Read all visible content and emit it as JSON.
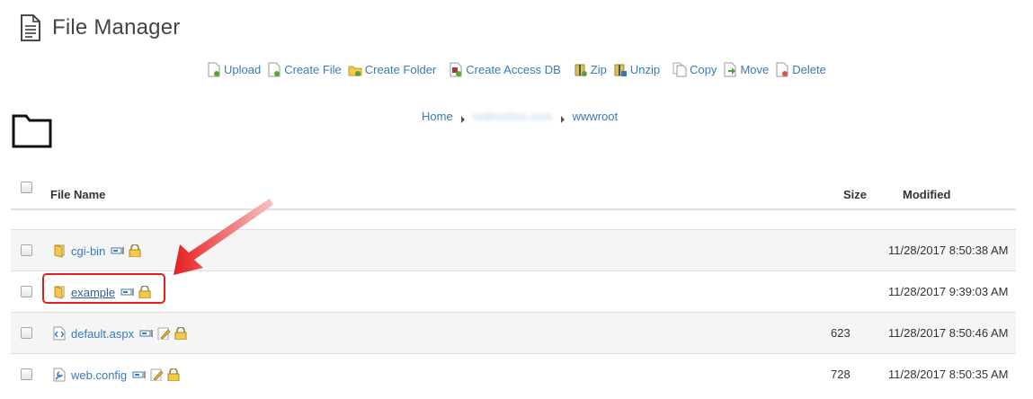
{
  "header": {
    "title": "File Manager",
    "icon": "document-icon"
  },
  "toolbar": [
    {
      "label": "Upload",
      "icon": "upload-icon"
    },
    {
      "label": "Create File",
      "icon": "create-file-icon"
    },
    {
      "label": "Create Folder",
      "icon": "create-folder-icon"
    },
    {
      "label": "Create Access DB",
      "icon": "create-access-db-icon"
    },
    {
      "label": "Zip",
      "icon": "zip-icon"
    },
    {
      "label": "Unzip",
      "icon": "unzip-icon"
    },
    {
      "label": "Copy",
      "icon": "copy-icon"
    },
    {
      "label": "Move",
      "icon": "move-icon"
    },
    {
      "label": "Delete",
      "icon": "delete-icon"
    }
  ],
  "breadcrumb": {
    "home": "Home",
    "domain": "redirection.com",
    "current": "wwwroot"
  },
  "table": {
    "headers": {
      "name": "File Name",
      "size": "Size",
      "modified": "Modified"
    },
    "rows": [
      {
        "name": "cgi-bin",
        "type": "folder",
        "size": "",
        "modified": "11/28/2017 8:50:38 AM"
      },
      {
        "name": "example",
        "type": "folder",
        "size": "",
        "modified": "11/28/2017 9:39:03 AM"
      },
      {
        "name": "default.aspx",
        "type": "aspx",
        "size": "623",
        "modified": "11/28/2017 8:50:46 AM"
      },
      {
        "name": "web.config",
        "type": "config",
        "size": "728",
        "modified": "11/28/2017 8:50:35 AM"
      }
    ]
  },
  "colors": {
    "link": "#3a79b8",
    "highlight": "#e02020",
    "row_alt": "#f5f5f5"
  }
}
